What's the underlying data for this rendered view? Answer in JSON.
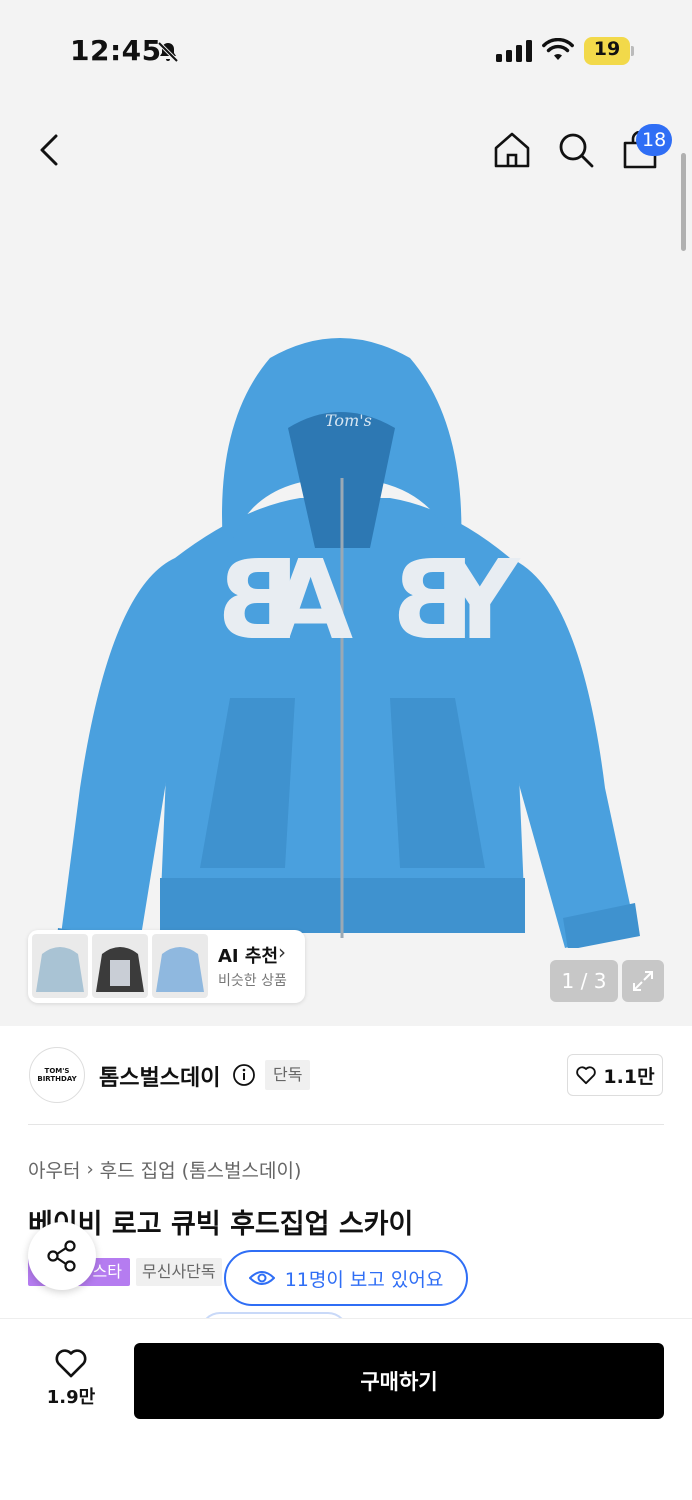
{
  "status_bar": {
    "time": "12:45",
    "battery": "19"
  },
  "header": {
    "cart_count": "18"
  },
  "gallery": {
    "page_indicator": "1 / 3",
    "ai_recommend": {
      "title": "AI 추천",
      "subtitle": "비슷한 상품"
    }
  },
  "brand": {
    "name": "톰스벌스데이",
    "tag": "단독",
    "likes": "1.1만"
  },
  "product": {
    "breadcrumb": [
      "아우터",
      "후드 집업 (톰스벌스데이)"
    ],
    "title": "베이비 로고 큐빅 후드집업 스카이",
    "tags": [
      "스타",
      "무신사단독"
    ],
    "viewers": "11명이 보고 있어요"
  },
  "bottom_bar": {
    "wish_count": "1.9만",
    "buy_label": "구매하기"
  },
  "colors": {
    "accent": "#2f6ef5",
    "hoodie": "#4aa0de",
    "tag_purple": "#b57cf0"
  }
}
